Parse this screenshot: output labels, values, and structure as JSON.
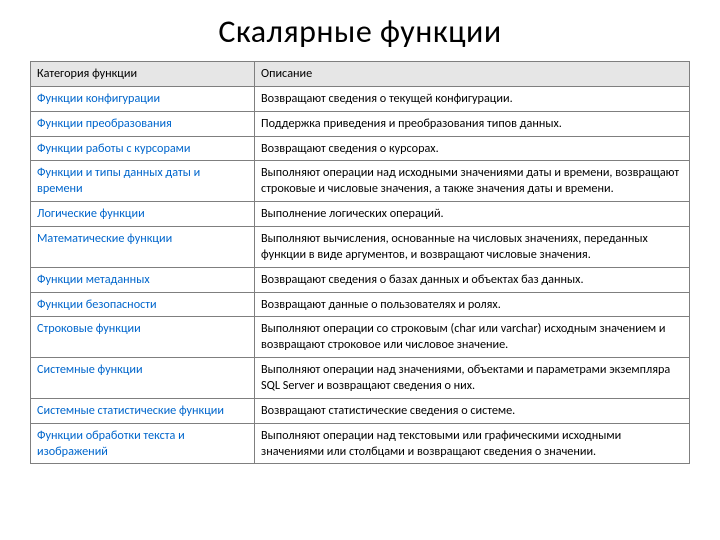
{
  "title": "Скалярные функции",
  "headers": {
    "col1": "Категория функции",
    "col2": "Описание"
  },
  "rows": [
    {
      "cat": "Функции конфигурации",
      "link": true,
      "desc": "Возвращают сведения о текущей конфигурации."
    },
    {
      "cat": "Функции преобразования",
      "link": true,
      "desc": "Поддержка приведения и преобразования типов данных."
    },
    {
      "cat": "Функции работы с курсорами",
      "link": true,
      "desc": "Возвращают сведения о курсорах."
    },
    {
      "cat": "Функции и типы данных даты и времени",
      "link": true,
      "desc": "Выполняют операции над исходными значениями даты и времени, возвращают строковые и числовые значения, а также значения даты и времени."
    },
    {
      "cat": "Логические функции",
      "link": true,
      "desc": "Выполнение логических операций."
    },
    {
      "cat": "Математические функции",
      "link": true,
      "desc": "Выполняют вычисления, основанные на числовых значениях, переданных функции в виде аргументов, и возвращают числовые значения."
    },
    {
      "cat": "Функции метаданных",
      "link": true,
      "desc": "Возвращают сведения о базах данных и объектах баз данных."
    },
    {
      "cat": "Функции безопасности",
      "link": true,
      "desc": "Возвращают данные о пользователях и ролях."
    },
    {
      "cat": "Строковые функции",
      "link": true,
      "desc": "Выполняют операции со строковым (char или varchar) исходным значением и возвращают строковое или числовое значение."
    },
    {
      "cat": "Системные функции",
      "link": true,
      "desc": "Выполняют операции над значениями, объектами и параметрами экземпляра SQL Server и возвращают сведения о них."
    },
    {
      "cat": "Системные статистические функции",
      "link": true,
      "desc": "Возвращают статистические сведения о системе."
    },
    {
      "cat": "Функции обработки текста и изображений",
      "link": true,
      "desc": "Выполняют операции над текстовыми или графическими исходными значениями или столбцами и возвращают сведения о значении."
    }
  ]
}
